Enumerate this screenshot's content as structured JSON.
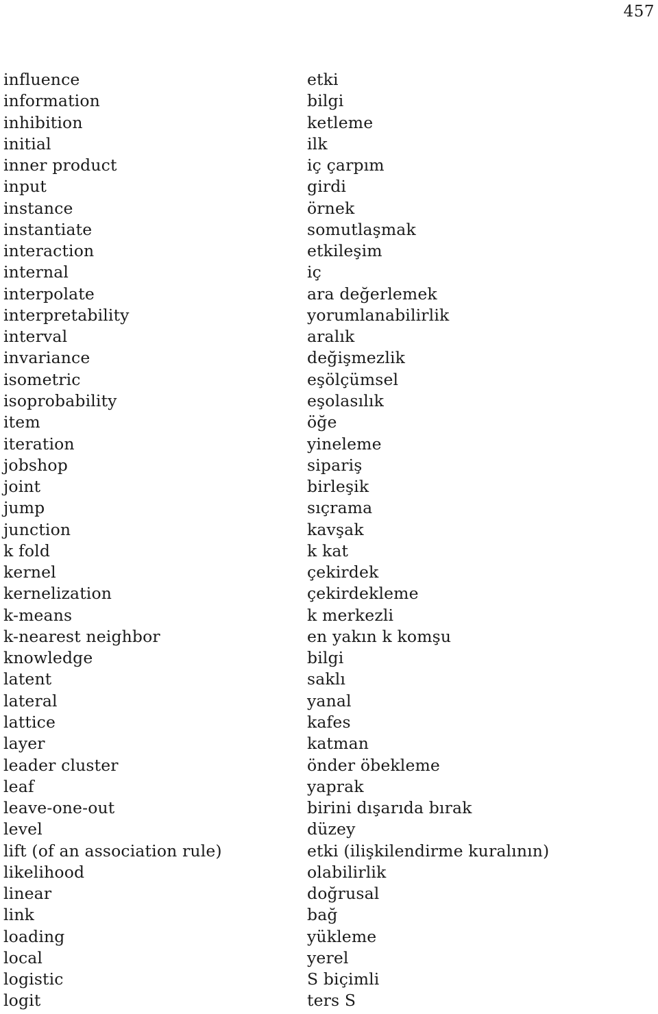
{
  "page": {
    "number": "457",
    "text_color": "#1b1b1b",
    "background_color": "#ffffff"
  },
  "glossary": {
    "entries": [
      {
        "source": "influence",
        "target": "etki"
      },
      {
        "source": "information",
        "target": "bilgi"
      },
      {
        "source": "inhibition",
        "target": "ketleme"
      },
      {
        "source": "initial",
        "target": "ilk"
      },
      {
        "source": "inner product",
        "target": "iç çarpım"
      },
      {
        "source": "input",
        "target": "girdi"
      },
      {
        "source": "instance",
        "target": "örnek"
      },
      {
        "source": "instantiate",
        "target": "somutlaşmak"
      },
      {
        "source": "interaction",
        "target": "etkileşim"
      },
      {
        "source": "internal",
        "target": "iç"
      },
      {
        "source": "interpolate",
        "target": "ara değerlemek"
      },
      {
        "source": "interpretability",
        "target": "yorumlanabilirlik"
      },
      {
        "source": "interval",
        "target": "aralık"
      },
      {
        "source": "invariance",
        "target": "değişmezlik"
      },
      {
        "source": "isometric",
        "target": "eşölçümsel"
      },
      {
        "source": "isoprobability",
        "target": "eşolasılık"
      },
      {
        "source": "item",
        "target": "öğe"
      },
      {
        "source": "iteration",
        "target": "yineleme"
      },
      {
        "source": "jobshop",
        "target": "sipariş"
      },
      {
        "source": "joint",
        "target": "birleşik"
      },
      {
        "source": "jump",
        "target": "sıçrama"
      },
      {
        "source": "junction",
        "target": "kavşak"
      },
      {
        "source": "k fold",
        "target": "k kat"
      },
      {
        "source": "kernel",
        "target": "çekirdek"
      },
      {
        "source": "kernelization",
        "target": "çekirdekleme"
      },
      {
        "source": "k-means",
        "target": "k merkezli"
      },
      {
        "source": "k-nearest neighbor",
        "target": "en yakın k komşu"
      },
      {
        "source": "knowledge",
        "target": "bilgi"
      },
      {
        "source": "latent",
        "target": "saklı"
      },
      {
        "source": "lateral",
        "target": "yanal"
      },
      {
        "source": "lattice",
        "target": "kafes"
      },
      {
        "source": "layer",
        "target": "katman"
      },
      {
        "source": "leader cluster",
        "target": "önder öbekleme"
      },
      {
        "source": "leaf",
        "target": "yaprak"
      },
      {
        "source": "leave-one-out",
        "target": "birini dışarıda bırak"
      },
      {
        "source": "level",
        "target": "düzey"
      },
      {
        "source": "lift (of an association rule)",
        "target": "etki (ilişkilendirme kuralının)"
      },
      {
        "source": "likelihood",
        "target": "olabilirlik"
      },
      {
        "source": "linear",
        "target": "doğrusal"
      },
      {
        "source": "link",
        "target": "bağ"
      },
      {
        "source": "loading",
        "target": "yükleme"
      },
      {
        "source": "local",
        "target": "yerel"
      },
      {
        "source": "logistic",
        "target": "S biçimli"
      },
      {
        "source": "logit",
        "target": "ters S"
      }
    ]
  }
}
